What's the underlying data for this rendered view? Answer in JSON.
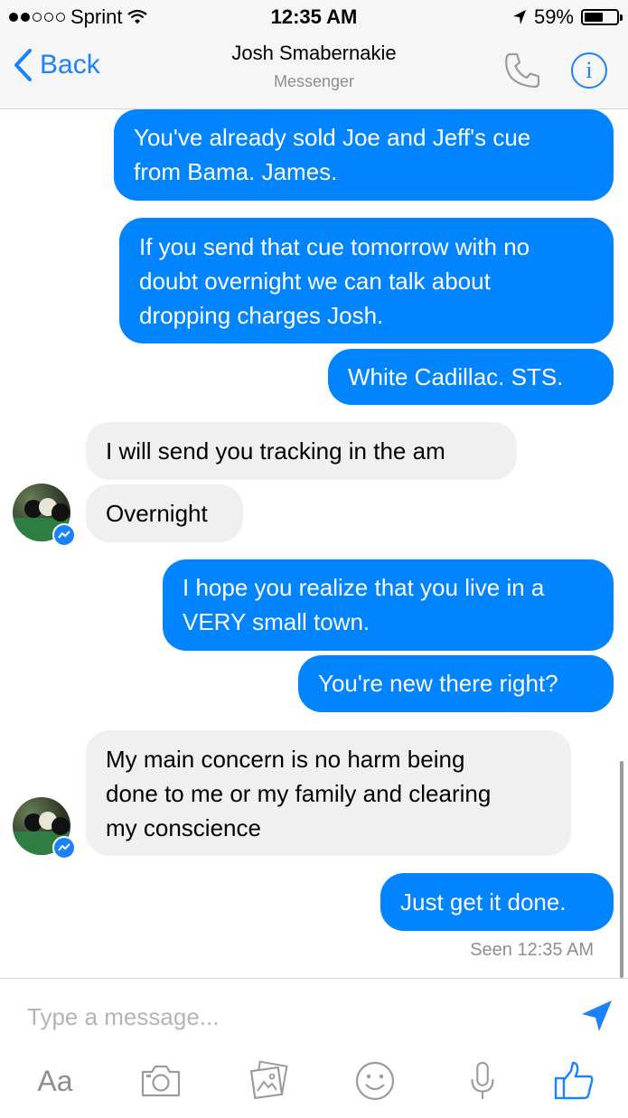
{
  "status_bar": {
    "carrier": "Sprint",
    "time": "12:35 AM",
    "battery": "59%",
    "battery_level": 0.59,
    "signal_bars": 2,
    "signal_total": 5
  },
  "header": {
    "back_label": "Back",
    "title": "Josh Smabernakie",
    "subtitle": "Messenger",
    "icons": [
      "chevron-left-icon",
      "phone-icon",
      "info-icon"
    ]
  },
  "messages": [
    {
      "sender": "me",
      "text": "You've already sold Joe and Jeff's cue\nfrom Bama. James."
    },
    {
      "sender": "me",
      "text": "If you send that cue tomorrow with no\ndoubt overnight we can talk about\ndropping charges Josh."
    },
    {
      "sender": "me",
      "text": "White Cadillac. STS."
    },
    {
      "sender": "them",
      "text": "I will send you tracking in the am"
    },
    {
      "sender": "them",
      "text": "Overnight"
    },
    {
      "sender": "me",
      "text": "I hope you realize that you live in a\nVERY small town."
    },
    {
      "sender": "me",
      "text": "You're new there right?"
    },
    {
      "sender": "them",
      "text": "My main concern is no harm being\ndone to me or my family and clearing\nmy conscience"
    },
    {
      "sender": "me",
      "text": "Just get it done."
    }
  ],
  "seen_status": "Seen 12:35 AM",
  "composer": {
    "placeholder": "Type a message...",
    "aa_label": "Aa",
    "tools": [
      "text-format-icon",
      "camera-icon",
      "photo-gallery-icon",
      "emoji-icon",
      "microphone-icon",
      "thumbs-up-icon"
    ]
  },
  "colors": {
    "accent": "#1a82fb",
    "outgoing_bubble": "#0084ff",
    "incoming_bubble": "#f0f0f0",
    "bar_background": "#f6f6f7"
  }
}
